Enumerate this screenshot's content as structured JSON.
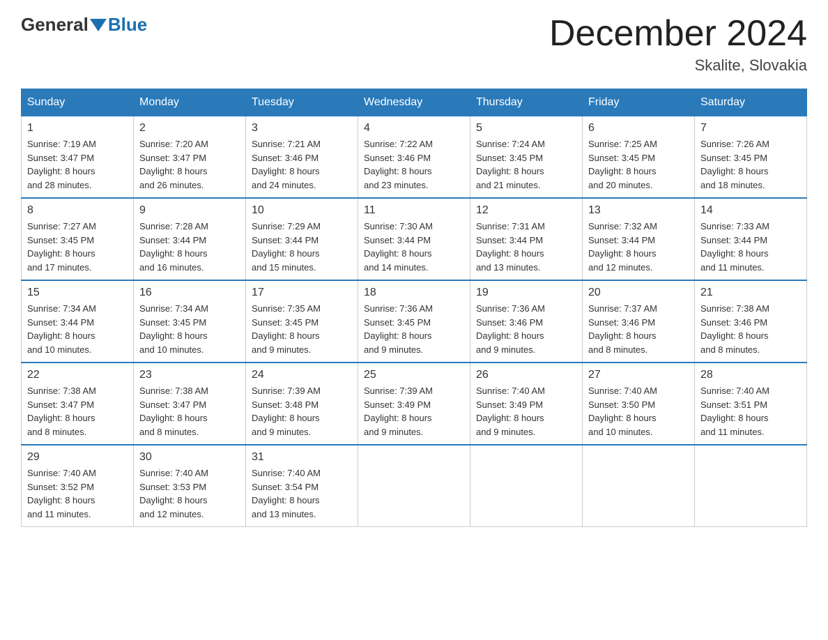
{
  "header": {
    "logo_general": "General",
    "logo_blue": "Blue",
    "month_title": "December 2024",
    "location": "Skalite, Slovakia"
  },
  "days_of_week": [
    "Sunday",
    "Monday",
    "Tuesday",
    "Wednesday",
    "Thursday",
    "Friday",
    "Saturday"
  ],
  "weeks": [
    [
      {
        "day": "1",
        "sunrise": "7:19 AM",
        "sunset": "3:47 PM",
        "daylight": "8 hours and 28 minutes."
      },
      {
        "day": "2",
        "sunrise": "7:20 AM",
        "sunset": "3:47 PM",
        "daylight": "8 hours and 26 minutes."
      },
      {
        "day": "3",
        "sunrise": "7:21 AM",
        "sunset": "3:46 PM",
        "daylight": "8 hours and 24 minutes."
      },
      {
        "day": "4",
        "sunrise": "7:22 AM",
        "sunset": "3:46 PM",
        "daylight": "8 hours and 23 minutes."
      },
      {
        "day": "5",
        "sunrise": "7:24 AM",
        "sunset": "3:45 PM",
        "daylight": "8 hours and 21 minutes."
      },
      {
        "day": "6",
        "sunrise": "7:25 AM",
        "sunset": "3:45 PM",
        "daylight": "8 hours and 20 minutes."
      },
      {
        "day": "7",
        "sunrise": "7:26 AM",
        "sunset": "3:45 PM",
        "daylight": "8 hours and 18 minutes."
      }
    ],
    [
      {
        "day": "8",
        "sunrise": "7:27 AM",
        "sunset": "3:45 PM",
        "daylight": "8 hours and 17 minutes."
      },
      {
        "day": "9",
        "sunrise": "7:28 AM",
        "sunset": "3:44 PM",
        "daylight": "8 hours and 16 minutes."
      },
      {
        "day": "10",
        "sunrise": "7:29 AM",
        "sunset": "3:44 PM",
        "daylight": "8 hours and 15 minutes."
      },
      {
        "day": "11",
        "sunrise": "7:30 AM",
        "sunset": "3:44 PM",
        "daylight": "8 hours and 14 minutes."
      },
      {
        "day": "12",
        "sunrise": "7:31 AM",
        "sunset": "3:44 PM",
        "daylight": "8 hours and 13 minutes."
      },
      {
        "day": "13",
        "sunrise": "7:32 AM",
        "sunset": "3:44 PM",
        "daylight": "8 hours and 12 minutes."
      },
      {
        "day": "14",
        "sunrise": "7:33 AM",
        "sunset": "3:44 PM",
        "daylight": "8 hours and 11 minutes."
      }
    ],
    [
      {
        "day": "15",
        "sunrise": "7:34 AM",
        "sunset": "3:44 PM",
        "daylight": "8 hours and 10 minutes."
      },
      {
        "day": "16",
        "sunrise": "7:34 AM",
        "sunset": "3:45 PM",
        "daylight": "8 hours and 10 minutes."
      },
      {
        "day": "17",
        "sunrise": "7:35 AM",
        "sunset": "3:45 PM",
        "daylight": "8 hours and 9 minutes."
      },
      {
        "day": "18",
        "sunrise": "7:36 AM",
        "sunset": "3:45 PM",
        "daylight": "8 hours and 9 minutes."
      },
      {
        "day": "19",
        "sunrise": "7:36 AM",
        "sunset": "3:46 PM",
        "daylight": "8 hours and 9 minutes."
      },
      {
        "day": "20",
        "sunrise": "7:37 AM",
        "sunset": "3:46 PM",
        "daylight": "8 hours and 8 minutes."
      },
      {
        "day": "21",
        "sunrise": "7:38 AM",
        "sunset": "3:46 PM",
        "daylight": "8 hours and 8 minutes."
      }
    ],
    [
      {
        "day": "22",
        "sunrise": "7:38 AM",
        "sunset": "3:47 PM",
        "daylight": "8 hours and 8 minutes."
      },
      {
        "day": "23",
        "sunrise": "7:38 AM",
        "sunset": "3:47 PM",
        "daylight": "8 hours and 8 minutes."
      },
      {
        "day": "24",
        "sunrise": "7:39 AM",
        "sunset": "3:48 PM",
        "daylight": "8 hours and 9 minutes."
      },
      {
        "day": "25",
        "sunrise": "7:39 AM",
        "sunset": "3:49 PM",
        "daylight": "8 hours and 9 minutes."
      },
      {
        "day": "26",
        "sunrise": "7:40 AM",
        "sunset": "3:49 PM",
        "daylight": "8 hours and 9 minutes."
      },
      {
        "day": "27",
        "sunrise": "7:40 AM",
        "sunset": "3:50 PM",
        "daylight": "8 hours and 10 minutes."
      },
      {
        "day": "28",
        "sunrise": "7:40 AM",
        "sunset": "3:51 PM",
        "daylight": "8 hours and 11 minutes."
      }
    ],
    [
      {
        "day": "29",
        "sunrise": "7:40 AM",
        "sunset": "3:52 PM",
        "daylight": "8 hours and 11 minutes."
      },
      {
        "day": "30",
        "sunrise": "7:40 AM",
        "sunset": "3:53 PM",
        "daylight": "8 hours and 12 minutes."
      },
      {
        "day": "31",
        "sunrise": "7:40 AM",
        "sunset": "3:54 PM",
        "daylight": "8 hours and 13 minutes."
      },
      null,
      null,
      null,
      null
    ]
  ],
  "labels": {
    "sunrise": "Sunrise:",
    "sunset": "Sunset:",
    "daylight": "Daylight:"
  }
}
